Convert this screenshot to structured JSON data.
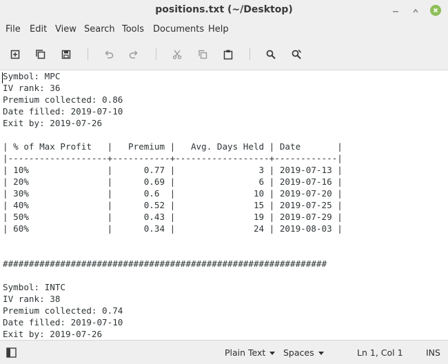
{
  "window": {
    "title": "positions.txt (~/Desktop)"
  },
  "menu": [
    "File",
    "Edit",
    "View",
    "Search",
    "Tools",
    "Documents",
    "Help"
  ],
  "toolbar": {
    "icons": [
      "new-document-icon",
      "open-icon",
      "save-icon",
      "undo-icon",
      "redo-icon",
      "cut-icon",
      "copy-icon",
      "paste-icon",
      "find-icon",
      "find-replace-icon"
    ]
  },
  "editor": {
    "lines": [
      "Symbol: MPC",
      "IV rank: 36",
      "Premium collected: 0.86",
      "Date filled: 2019-07-10",
      "Exit by: 2019-07-26",
      "",
      "| % of Max Profit   |   Premium |   Avg. Days Held | Date       |",
      "|-------------------+-----------+------------------+------------|",
      "| 10%               |      0.77 |                3 | 2019-07-13 |",
      "| 20%               |      0.69 |                6 | 2019-07-16 |",
      "| 30%               |      0.6  |               10 | 2019-07-20 |",
      "| 40%               |      0.52 |               15 | 2019-07-25 |",
      "| 50%               |      0.43 |               19 | 2019-07-29 |",
      "| 60%               |      0.34 |               24 | 2019-08-03 |",
      "",
      "",
      "##############################################################",
      "",
      "Symbol: INTC",
      "IV rank: 38",
      "Premium collected: 0.74",
      "Date filled: 2019-07-10",
      "Exit by: 2019-07-26"
    ]
  },
  "status": {
    "language": "Plain Text",
    "indent": "Spaces",
    "position": "Ln 1, Col 1",
    "mode": "INS"
  }
}
